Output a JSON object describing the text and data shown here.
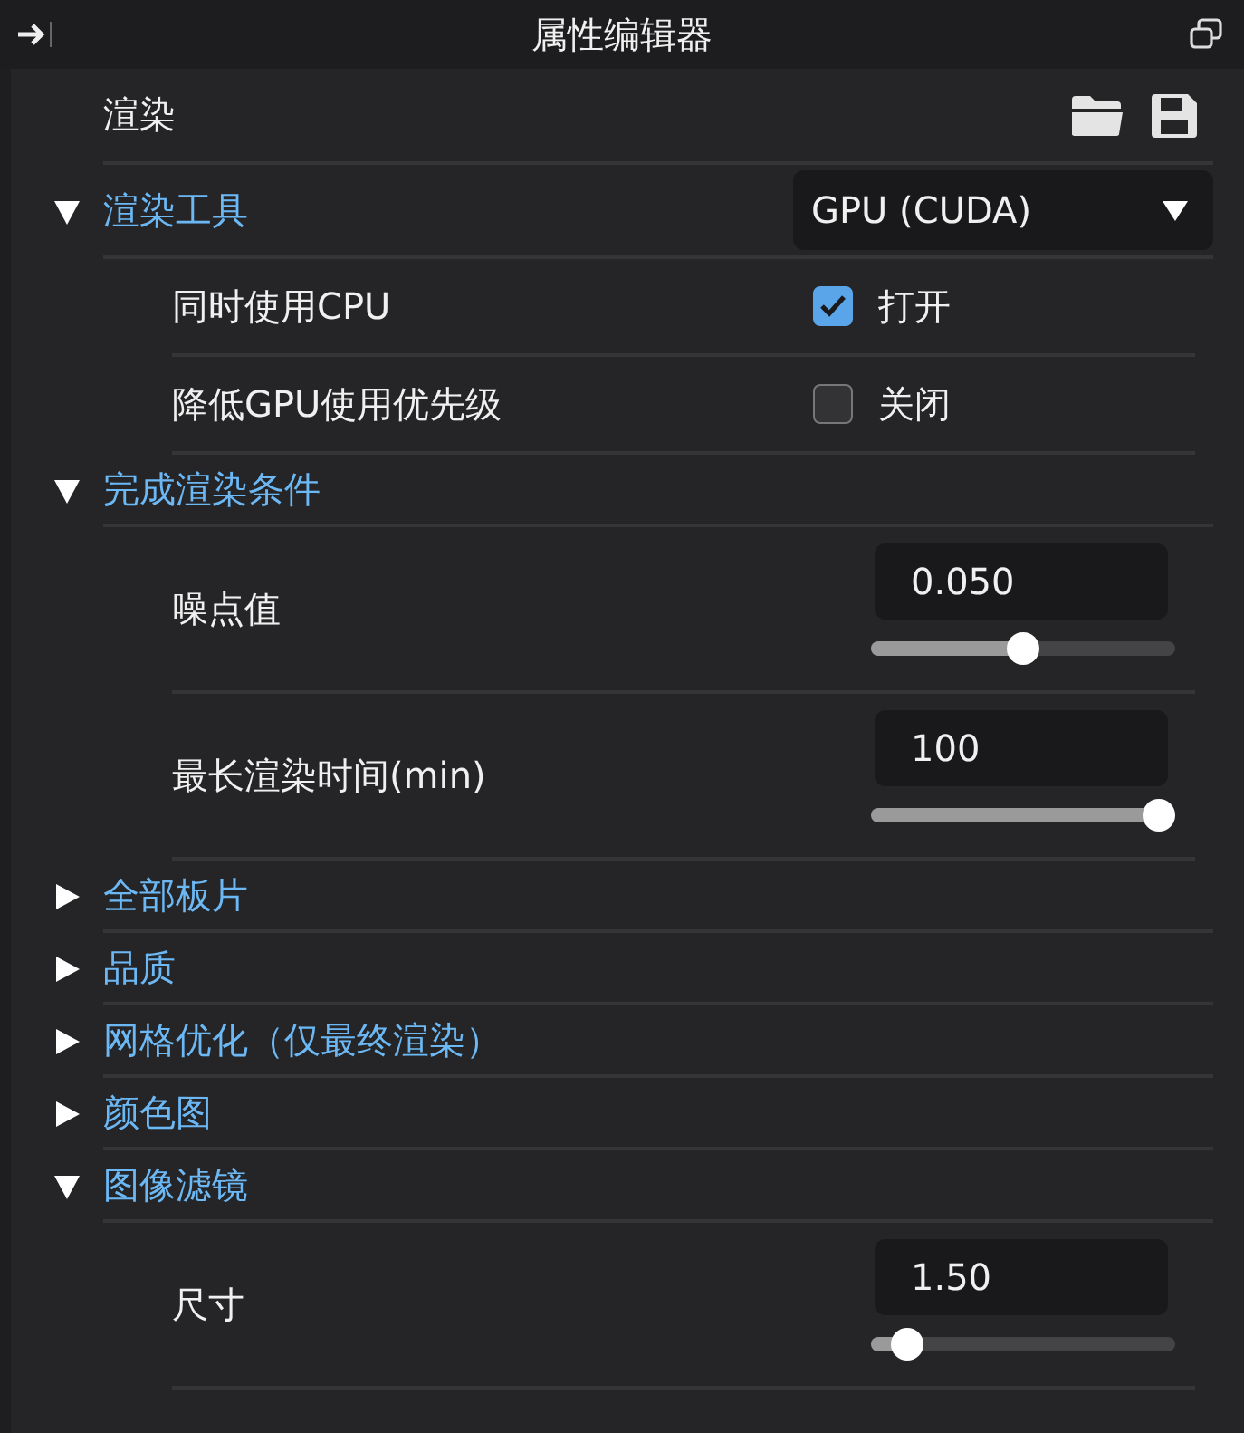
{
  "window": {
    "title": "属性编辑器"
  },
  "header": {
    "title": "渲染"
  },
  "sections": [
    {
      "title": "渲染工具",
      "expanded": true,
      "dropdown": "GPU (CUDA)",
      "items": [
        {
          "kind": "checkbox",
          "label": "同时使用CPU",
          "checked": true,
          "value": "打开"
        },
        {
          "kind": "checkbox",
          "label": "降低GPU使用优先级",
          "checked": false,
          "value": "关闭"
        }
      ]
    },
    {
      "title": "完成渲染条件",
      "expanded": true,
      "items": [
        {
          "kind": "slider",
          "label": "噪点值",
          "value": "0.050",
          "level": 0.5
        },
        {
          "kind": "slider",
          "label": "最长渲染时间(min)",
          "value": "100",
          "level": 1.0
        }
      ]
    },
    {
      "title": "全部板片",
      "expanded": false
    },
    {
      "title": "品质",
      "expanded": false
    },
    {
      "title": "网格优化（仅最终渲染）",
      "expanded": false
    },
    {
      "title": "颜色图",
      "expanded": false
    },
    {
      "title": "图像滤镜",
      "expanded": true,
      "items": [
        {
          "kind": "slider",
          "label": "尺寸",
          "value": "1.50",
          "level": 0.07
        }
      ]
    }
  ]
}
